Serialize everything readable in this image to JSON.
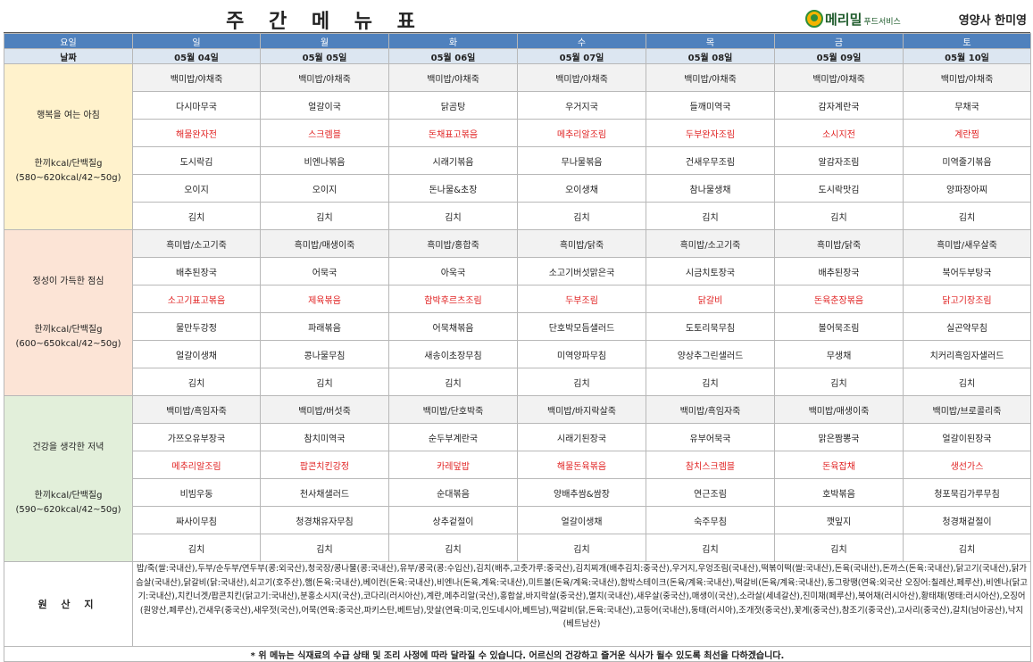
{
  "header": {
    "title": "주 간 메 뉴 표",
    "logo_main": "메리밀",
    "logo_sub": "푸드서비스",
    "dietitian": "영양사 한미영"
  },
  "labels": {
    "day": "요일",
    "date": "날짜",
    "origin": "원 산 지"
  },
  "days": [
    "일",
    "월",
    "화",
    "수",
    "목",
    "금",
    "토"
  ],
  "dates": [
    "05월 04일",
    "05월 05일",
    "05월 06일",
    "05월 07일",
    "05월 08일",
    "05월 09일",
    "05월 10일"
  ],
  "meals": [
    {
      "title": "행복을 여는 아침",
      "kcal": "한끼kcal/단백질g",
      "range": "(580~620kcal/42~50g)",
      "rows": [
        [
          "백미밥/야채죽",
          "백미밥/야채죽",
          "백미밥/야채죽",
          "백미밥/야채죽",
          "백미밥/야채죽",
          "백미밥/야채죽",
          "백미밥/야채죽"
        ],
        [
          "다시마무국",
          "얼갈이국",
          "닭곰탕",
          "우거지국",
          "들깨미역국",
          "감자계란국",
          "무채국"
        ],
        [
          "해물완자전",
          "스크렘블",
          "돈채표고볶음",
          "메추리알조림",
          "두부완자조림",
          "소시지전",
          "계란찜"
        ],
        [
          "도시락김",
          "비엔나볶음",
          "시래기볶음",
          "무나물볶음",
          "건새우무조림",
          "알감자조림",
          "미역줄기볶음"
        ],
        [
          "오이지",
          "오이지",
          "돈나물&초장",
          "오이생채",
          "참나물생채",
          "도시락맛김",
          "양파장아찌"
        ],
        [
          "김치",
          "김치",
          "김치",
          "김치",
          "김치",
          "김치",
          "김치"
        ]
      ]
    },
    {
      "title": "정성이 가득한 점심",
      "kcal": "한끼kcal/단백질g",
      "range": "(600~650kcal/42~50g)",
      "rows": [
        [
          "흑미밥/소고기죽",
          "흑미밥/매생이죽",
          "흑미밥/홍합죽",
          "흑미밥/닭죽",
          "흑미밥/소고기죽",
          "흑미밥/닭죽",
          "흑미밥/새우살죽"
        ],
        [
          "배추된장국",
          "어묵국",
          "아욱국",
          "소고기버섯맑은국",
          "시금치토장국",
          "배추된장국",
          "북어두부탕국"
        ],
        [
          "소고기표고볶음",
          "제육볶음",
          "함박후르츠조림",
          "두부조림",
          "닭갈비",
          "돈육춘장볶음",
          "닭고기장조림"
        ],
        [
          "물만두강정",
          "파래볶음",
          "어묵채볶음",
          "단호박모듬샐러드",
          "도토리묵무침",
          "볼어묵조림",
          "실곤약무침"
        ],
        [
          "얼갈이생채",
          "콩나물무침",
          "새송이초장무침",
          "미역양파무침",
          "양상추그린샐러드",
          "무생채",
          "치커리흑임자샐러드"
        ],
        [
          "김치",
          "김치",
          "김치",
          "김치",
          "김치",
          "김치",
          "김치"
        ]
      ]
    },
    {
      "title": "건강을 생각한 저녁",
      "kcal": "한끼kcal/단백질g",
      "range": "(590~620kcal/42~50g)",
      "rows": [
        [
          "백미밥/흑임자죽",
          "백미밥/버섯죽",
          "백미밥/단호박죽",
          "백미밥/바지락살죽",
          "백미밥/흑임자죽",
          "백미밥/매생이죽",
          "백미밥/브로콜리죽"
        ],
        [
          "가쯔오유부장국",
          "참치미역국",
          "순두부계란국",
          "시래기된장국",
          "유부어묵국",
          "맑은짬뽕국",
          "얼갈이된장국"
        ],
        [
          "메추리알조림",
          "팝콘치킨강정",
          "카레덮밥",
          "해물돈육볶음",
          "참치스크렘블",
          "돈육잡채",
          "생선가스"
        ],
        [
          "비빔우동",
          "천사채샐러드",
          "순대볶음",
          "양배추쌈&쌈장",
          "연근조림",
          "호박볶음",
          "청포묵김가루무침"
        ],
        [
          "짜사이무침",
          "청경채유자무침",
          "상추겉절이",
          "얼갈이생채",
          "숙주무침",
          "깻잎지",
          "청경채겉절이"
        ],
        [
          "김치",
          "김치",
          "김치",
          "김치",
          "김치",
          "김치",
          "김치"
        ]
      ]
    }
  ],
  "origin_text": "밥/죽(쌀:국내산),두부/순두부/연두부(콩:외국산),청국장/콩나물(콩:국내산),유부/콩국(콩:수입산),김치(배추,고춧가루:중국산),김치찌개(배추김치:중국산),우거지,우엉조림(국내산),떡볶이떡(쌀:국내산),돈육(국내산),돈까스(돈육:국내산),닭고기(국내산),닭가슴살(국내산),닭갈비(닭:국내산),쇠고기(호주산),햄(돈육:국내산),베이컨(돈육:국내산),비엔나(돈육,계육:국내산),미트볼(돈육/계육:국내산),함박스테이크(돈육/계육:국내산),떡갈비(돈육/계육:국내산),동그랑땡(연육:외국산 오징어:칠레산,페루산),비엔나(닭고기:국내산),치킨너겟/팝콘치킨(닭고기:국내산),분홍소시지(국산),코다리(러시아산),계란,메추리알(국산),홍합살,바지락살(중국산),멸치(국내산),새우살(중국산),매생이(국산),소라살(세네갈산),진미채(페루산),북어채(러시아산),황태채(명태:러시아산),오징어(원양산,페루산),건새우(중국산),새우젓(국산),어묵(연육:중국산,파키스탄,베트남),맛살(연육:미국,인도네시아,베트남),떡갈비(닭,돈육:국내산),고등어(국내산),동태(러시아),조개젓(중국산),꽃게(중국산),참조기(중국산),고사리(중국산),갈치(남아공산),낙지(베트남산)",
  "footnote": "* 위 메뉴는 식재료의 수급 상태 및 조리 사정에 따라 달라질 수 있습니다. 어르신의 건강하고 즐거운 식사가 될수 있도록 최선을 다하겠습니다."
}
